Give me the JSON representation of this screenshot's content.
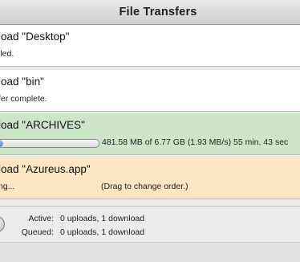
{
  "window": {
    "title": "File Transfers"
  },
  "transfers": [
    {
      "title": "load \"Desktop\"",
      "status": "lled."
    },
    {
      "title": "load \"bin\"",
      "status": "fer complete."
    },
    {
      "title": "load \"ARCHIVES\"",
      "progress": 0.07,
      "progress_text": "481.58 MB of 6.77 GB (1.93 MB/s) 55 min. 43 sec"
    },
    {
      "title": "load \"Azureus.app\"",
      "status": "ng...",
      "hint": "(Drag to change order.)"
    }
  ],
  "summary": {
    "active_label": "Active:",
    "active_value": "0 uploads, 1 download",
    "queued_label": "Queued:",
    "queued_value": "0 uploads, 1 download"
  },
  "colors": {
    "active_row": "#cde6c7",
    "waiting_row": "#fde7c2"
  }
}
